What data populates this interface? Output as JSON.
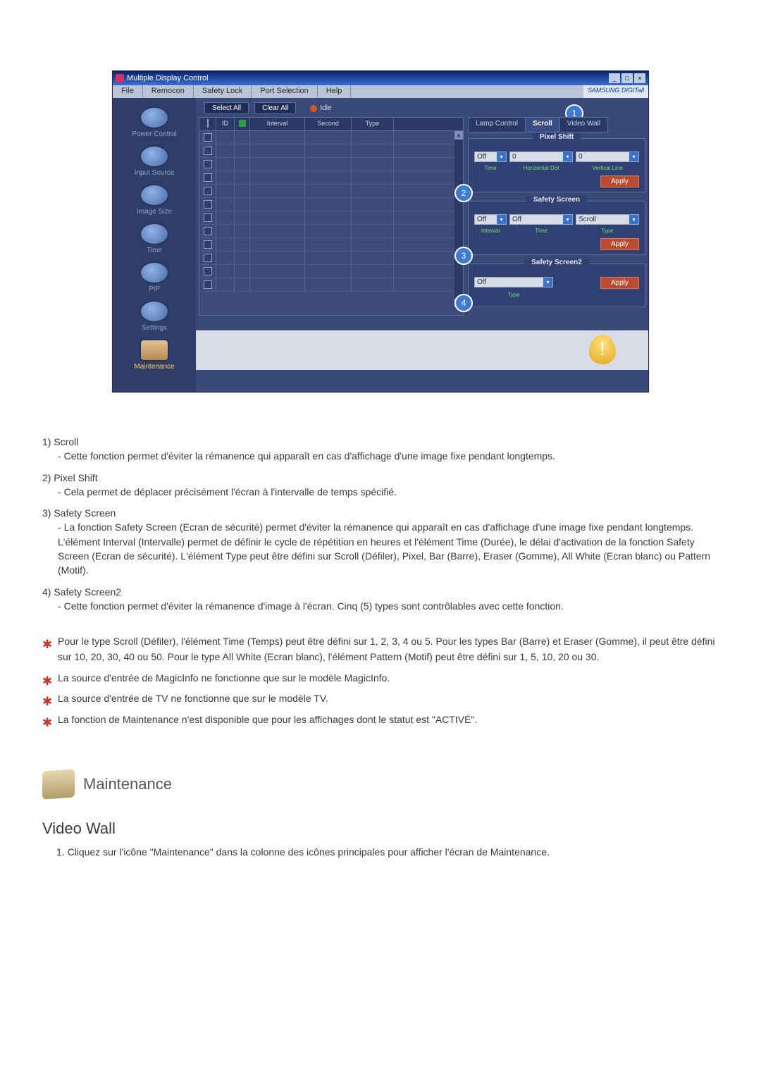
{
  "window": {
    "title": "Multiple Display Control",
    "menubar": [
      "File",
      "Remocon",
      "Safety Lock",
      "Port Selection",
      "Help"
    ],
    "brand": "SAMSUNG DIGITall"
  },
  "sidebar": {
    "items": [
      {
        "label": "Power Control",
        "active": false
      },
      {
        "label": "Input Source",
        "active": false
      },
      {
        "label": "Image Size",
        "active": false
      },
      {
        "label": "Time",
        "active": false
      },
      {
        "label": "PIP",
        "active": false
      },
      {
        "label": "Settings",
        "active": false
      },
      {
        "label": "Maintenance",
        "active": true
      }
    ]
  },
  "toolbar": {
    "select_all": "Select All",
    "clear_all": "Clear All",
    "idle": "Idle"
  },
  "grid": {
    "headers": {
      "id": "ID",
      "interval": "Interval",
      "second": "Second",
      "type": "Type"
    },
    "row_count": 12
  },
  "right": {
    "callouts": {
      "c1": "1",
      "c2": "2",
      "c3": "3",
      "c4": "4"
    },
    "tabs": [
      "Lamp Control",
      "Scroll",
      "Video Wall"
    ],
    "active_tab": 1,
    "groups": {
      "pixel_shift": {
        "title": "Pixel Shift",
        "time_value": "Off",
        "hdot_value": "0",
        "vline_value": "0",
        "labels": {
          "time": "Time",
          "hdot": "Horizontal Dot",
          "vline": "Vertical Line"
        },
        "apply": "Apply"
      },
      "safety_screen": {
        "title": "Safety Screen",
        "interval_value": "Off",
        "time_value": "Off",
        "type_value": "Scroll",
        "labels": {
          "interval": "Interval",
          "time": "Time",
          "type": "Type"
        },
        "apply": "Apply"
      },
      "safety_screen2": {
        "title": "Safety Screen2",
        "type_value": "Off",
        "labels": {
          "type": "Type"
        },
        "apply": "Apply"
      }
    }
  },
  "desc_list": [
    {
      "head": "1)  Scroll",
      "body": "Cette fonction permet d'éviter la rémanence qui apparaît en cas d'affichage d'une image fixe pendant longtemps."
    },
    {
      "head": "2)  Pixel Shift",
      "body": "Cela permet de déplacer précisément l'écran à l'intervalle de temps spécifié."
    },
    {
      "head": "3)  Safety Screen",
      "body": "La fonction Safety Screen (Ecran de sécurité) permet d'éviter la rémanence qui apparaît en cas d'affichage d'une image fixe pendant longtemps. L'élément Interval (Intervalle) permet de définir le cycle de répétition en heures et l'élément Time (Durée), le délai d'activation de la fonction Safety Screen (Ecran de sécurité). L'élément Type peut être défini sur Scroll (Défiler), Pixel, Bar (Barre), Eraser (Gomme), All White (Ecran blanc) ou Pattern (Motif)."
    },
    {
      "head": "4)  Safety Screen2",
      "body": "Cette fonction permet d'éviter la rémanence d'image à l'écran. Cinq (5) types sont contrôlables avec cette fonction."
    }
  ],
  "star_list": [
    "Pour le type Scroll (Défiler), l'élément Time (Temps) peut être défini sur 1, 2, 3, 4 ou 5. Pour les types Bar (Barre) et Eraser (Gomme), il peut être défini sur 10, 20, 30, 40 ou 50. Pour le type All White (Ecran blanc), l'élément Pattern (Motif) peut être défini sur 1, 5, 10, 20 ou 30.",
    "La source d'entrée de MagicInfo ne fonctionne que sur le modèle MagicInfo.",
    "La source d'entrée de TV ne fonctionne que sur le modèle TV.",
    "La fonction de Maintenance n'est disponible que pour les affichages dont le statut est \"ACTIVÉ\"."
  ],
  "section": {
    "title": "Maintenance"
  },
  "subsection": {
    "title": "Video Wall",
    "step1": "1.  Cliquez sur l'icône \"Maintenance\" dans la colonne des icônes principales pour afficher l'écran de Maintenance."
  }
}
